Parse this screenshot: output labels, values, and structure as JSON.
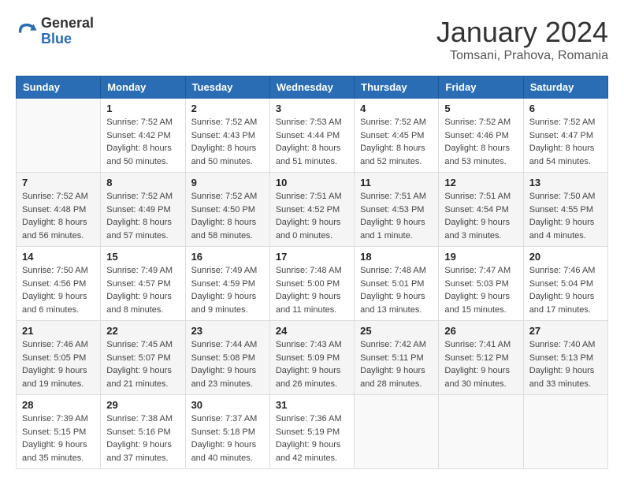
{
  "header": {
    "logo_general": "General",
    "logo_blue": "Blue",
    "month_year": "January 2024",
    "location": "Tomsani, Prahova, Romania"
  },
  "days_of_week": [
    "Sunday",
    "Monday",
    "Tuesday",
    "Wednesday",
    "Thursday",
    "Friday",
    "Saturday"
  ],
  "weeks": [
    [
      {
        "day": "",
        "info": ""
      },
      {
        "day": "1",
        "info": "Sunrise: 7:52 AM\nSunset: 4:42 PM\nDaylight: 8 hours\nand 50 minutes."
      },
      {
        "day": "2",
        "info": "Sunrise: 7:52 AM\nSunset: 4:43 PM\nDaylight: 8 hours\nand 50 minutes."
      },
      {
        "day": "3",
        "info": "Sunrise: 7:53 AM\nSunset: 4:44 PM\nDaylight: 8 hours\nand 51 minutes."
      },
      {
        "day": "4",
        "info": "Sunrise: 7:52 AM\nSunset: 4:45 PM\nDaylight: 8 hours\nand 52 minutes."
      },
      {
        "day": "5",
        "info": "Sunrise: 7:52 AM\nSunset: 4:46 PM\nDaylight: 8 hours\nand 53 minutes."
      },
      {
        "day": "6",
        "info": "Sunrise: 7:52 AM\nSunset: 4:47 PM\nDaylight: 8 hours\nand 54 minutes."
      }
    ],
    [
      {
        "day": "7",
        "info": "Sunrise: 7:52 AM\nSunset: 4:48 PM\nDaylight: 8 hours\nand 56 minutes."
      },
      {
        "day": "8",
        "info": "Sunrise: 7:52 AM\nSunset: 4:49 PM\nDaylight: 8 hours\nand 57 minutes."
      },
      {
        "day": "9",
        "info": "Sunrise: 7:52 AM\nSunset: 4:50 PM\nDaylight: 8 hours\nand 58 minutes."
      },
      {
        "day": "10",
        "info": "Sunrise: 7:51 AM\nSunset: 4:52 PM\nDaylight: 9 hours\nand 0 minutes."
      },
      {
        "day": "11",
        "info": "Sunrise: 7:51 AM\nSunset: 4:53 PM\nDaylight: 9 hours\nand 1 minute."
      },
      {
        "day": "12",
        "info": "Sunrise: 7:51 AM\nSunset: 4:54 PM\nDaylight: 9 hours\nand 3 minutes."
      },
      {
        "day": "13",
        "info": "Sunrise: 7:50 AM\nSunset: 4:55 PM\nDaylight: 9 hours\nand 4 minutes."
      }
    ],
    [
      {
        "day": "14",
        "info": "Sunrise: 7:50 AM\nSunset: 4:56 PM\nDaylight: 9 hours\nand 6 minutes."
      },
      {
        "day": "15",
        "info": "Sunrise: 7:49 AM\nSunset: 4:57 PM\nDaylight: 9 hours\nand 8 minutes."
      },
      {
        "day": "16",
        "info": "Sunrise: 7:49 AM\nSunset: 4:59 PM\nDaylight: 9 hours\nand 9 minutes."
      },
      {
        "day": "17",
        "info": "Sunrise: 7:48 AM\nSunset: 5:00 PM\nDaylight: 9 hours\nand 11 minutes."
      },
      {
        "day": "18",
        "info": "Sunrise: 7:48 AM\nSunset: 5:01 PM\nDaylight: 9 hours\nand 13 minutes."
      },
      {
        "day": "19",
        "info": "Sunrise: 7:47 AM\nSunset: 5:03 PM\nDaylight: 9 hours\nand 15 minutes."
      },
      {
        "day": "20",
        "info": "Sunrise: 7:46 AM\nSunset: 5:04 PM\nDaylight: 9 hours\nand 17 minutes."
      }
    ],
    [
      {
        "day": "21",
        "info": "Sunrise: 7:46 AM\nSunset: 5:05 PM\nDaylight: 9 hours\nand 19 minutes."
      },
      {
        "day": "22",
        "info": "Sunrise: 7:45 AM\nSunset: 5:07 PM\nDaylight: 9 hours\nand 21 minutes."
      },
      {
        "day": "23",
        "info": "Sunrise: 7:44 AM\nSunset: 5:08 PM\nDaylight: 9 hours\nand 23 minutes."
      },
      {
        "day": "24",
        "info": "Sunrise: 7:43 AM\nSunset: 5:09 PM\nDaylight: 9 hours\nand 26 minutes."
      },
      {
        "day": "25",
        "info": "Sunrise: 7:42 AM\nSunset: 5:11 PM\nDaylight: 9 hours\nand 28 minutes."
      },
      {
        "day": "26",
        "info": "Sunrise: 7:41 AM\nSunset: 5:12 PM\nDaylight: 9 hours\nand 30 minutes."
      },
      {
        "day": "27",
        "info": "Sunrise: 7:40 AM\nSunset: 5:13 PM\nDaylight: 9 hours\nand 33 minutes."
      }
    ],
    [
      {
        "day": "28",
        "info": "Sunrise: 7:39 AM\nSunset: 5:15 PM\nDaylight: 9 hours\nand 35 minutes."
      },
      {
        "day": "29",
        "info": "Sunrise: 7:38 AM\nSunset: 5:16 PM\nDaylight: 9 hours\nand 37 minutes."
      },
      {
        "day": "30",
        "info": "Sunrise: 7:37 AM\nSunset: 5:18 PM\nDaylight: 9 hours\nand 40 minutes."
      },
      {
        "day": "31",
        "info": "Sunrise: 7:36 AM\nSunset: 5:19 PM\nDaylight: 9 hours\nand 42 minutes."
      },
      {
        "day": "",
        "info": ""
      },
      {
        "day": "",
        "info": ""
      },
      {
        "day": "",
        "info": ""
      }
    ]
  ]
}
